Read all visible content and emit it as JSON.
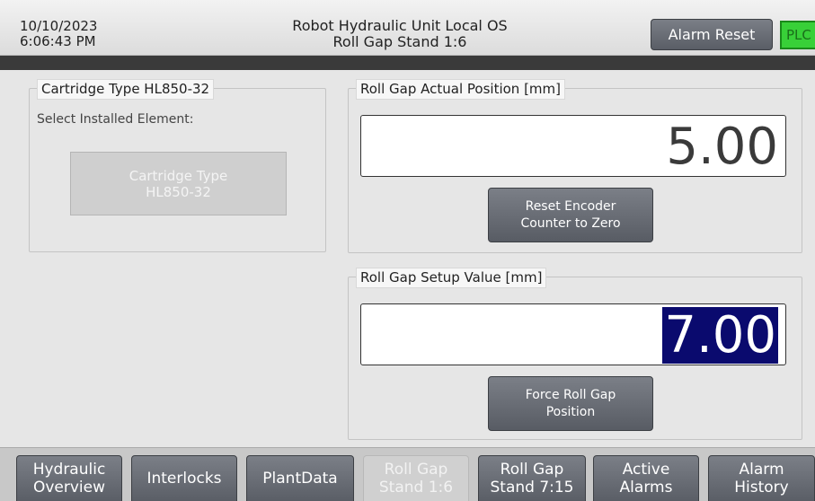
{
  "header": {
    "date": "10/10/2023",
    "time": "6:06:43 PM",
    "title_line1": "Robot Hydraulic Unit Local OS",
    "title_line2": "Roll Gap Stand 1:6",
    "alarm_reset_label": "Alarm Reset",
    "plc_label": "PLC"
  },
  "cartridge": {
    "group_label": "Cartridge Type HL850-32",
    "select_label": "Select Installed Element:",
    "button_line1": "Cartridge Type",
    "button_line2": "HL850-32"
  },
  "actual_position": {
    "group_label": "Roll Gap Actual Position [mm]",
    "value": "5.00",
    "reset_button_line1": "Reset Encoder",
    "reset_button_line2": "Counter to Zero"
  },
  "setup_value": {
    "group_label": "Roll Gap Setup Value [mm]",
    "value": "7.00",
    "force_button_line1": "Force Roll Gap",
    "force_button_line2": "Position"
  },
  "nav": [
    {
      "line1": "Hydraulic",
      "line2": "Overview"
    },
    {
      "line1": "Interlocks",
      "line2": ""
    },
    {
      "line1": "PlantData",
      "line2": ""
    },
    {
      "line1": "Roll Gap",
      "line2": "Stand 1:6"
    },
    {
      "line1": "Roll Gap",
      "line2": "Stand 7:15"
    },
    {
      "line1": "Active",
      "line2": "Alarms"
    },
    {
      "line1": "Alarm",
      "line2": "History"
    }
  ],
  "colors": {
    "plc_status": "#38d038",
    "selected_value_bg": "#0a0a6e",
    "button": "#6a6e76"
  }
}
